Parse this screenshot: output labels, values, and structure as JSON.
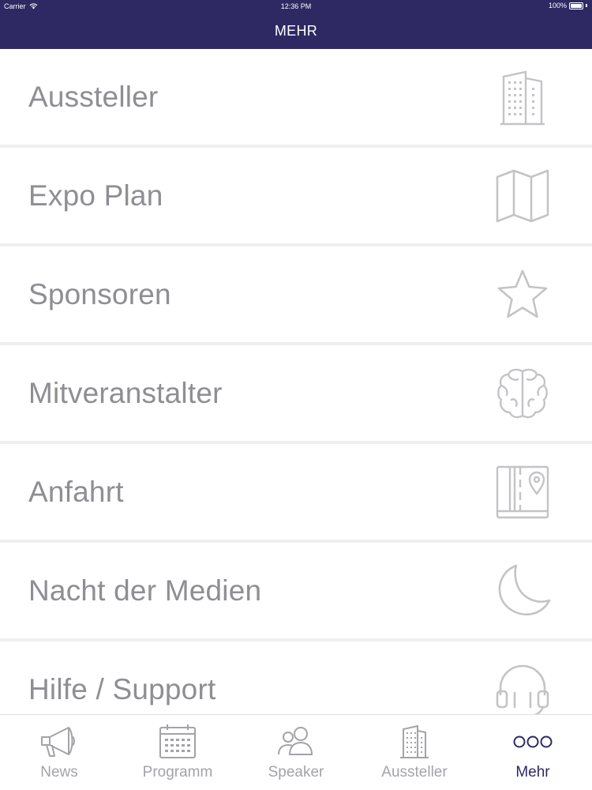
{
  "status_bar": {
    "carrier": "Carrier",
    "time": "12:36 PM",
    "battery": "100%"
  },
  "nav": {
    "title": "MEHR"
  },
  "menu": {
    "items": [
      {
        "label": "Aussteller",
        "icon": "building-icon"
      },
      {
        "label": "Expo Plan",
        "icon": "map-icon"
      },
      {
        "label": "Sponsoren",
        "icon": "star-icon"
      },
      {
        "label": "Mitveranstalter",
        "icon": "brain-icon"
      },
      {
        "label": "Anfahrt",
        "icon": "map-book-icon"
      },
      {
        "label": "Nacht der Medien",
        "icon": "moon-icon"
      },
      {
        "label": "Hilfe / Support",
        "icon": "headset-icon"
      }
    ]
  },
  "tabbar": {
    "tabs": [
      {
        "label": "News",
        "icon": "megaphone-icon",
        "active": false
      },
      {
        "label": "Programm",
        "icon": "calendar-icon",
        "active": false
      },
      {
        "label": "Speaker",
        "icon": "people-icon",
        "active": false
      },
      {
        "label": "Aussteller",
        "icon": "building-icon",
        "active": false
      },
      {
        "label": "Mehr",
        "icon": "more-icon",
        "active": true
      }
    ]
  },
  "colors": {
    "brand": "#2e2963",
    "menu_text": "#8e8e93",
    "icon_stroke": "#c4c4c7",
    "tab_inactive": "#a3a3a8"
  }
}
